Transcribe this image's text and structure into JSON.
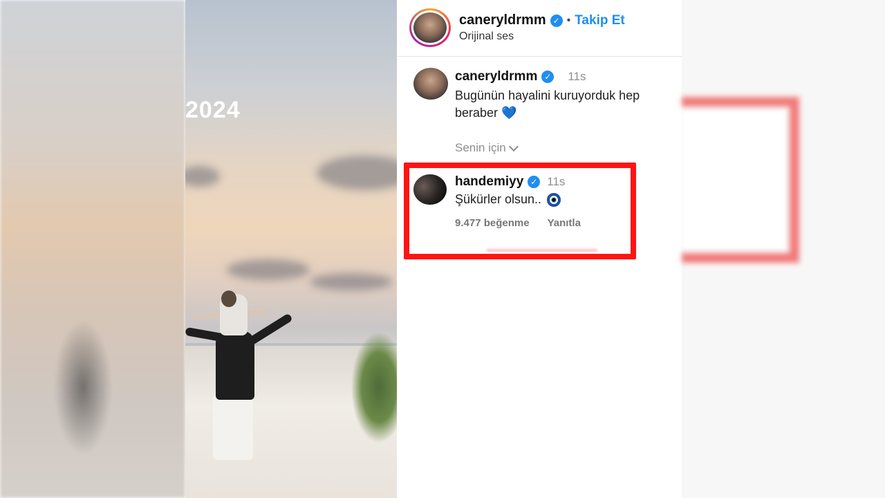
{
  "photo": {
    "year_overlay": "2024"
  },
  "post": {
    "author": "caneryldrmm",
    "separator": "•",
    "follow_label": "Takip Et",
    "audio_label": "Orijinal ses",
    "verified_icon": "verified-badge-icon"
  },
  "caption_comment": {
    "username": "caneryldrmm",
    "time": "11s",
    "text": "Bugünün hayalini kuruyorduk hep beraber",
    "emoji": "💙"
  },
  "sort_toggle": {
    "label": "Senin için",
    "icon": "chevron-down-icon"
  },
  "highlighted_comment": {
    "username": "handemiyy",
    "time": "11s",
    "text": "Şükürler olsun..",
    "emoji_icon": "evil-eye-icon",
    "likes": "9.477 beğenme",
    "reply_label": "Yanıtla",
    "highlight_color": "#ff1414"
  },
  "colors": {
    "accent": "#1f8ef1",
    "verified": "#1f8ef1",
    "highlight": "#ff1414"
  }
}
